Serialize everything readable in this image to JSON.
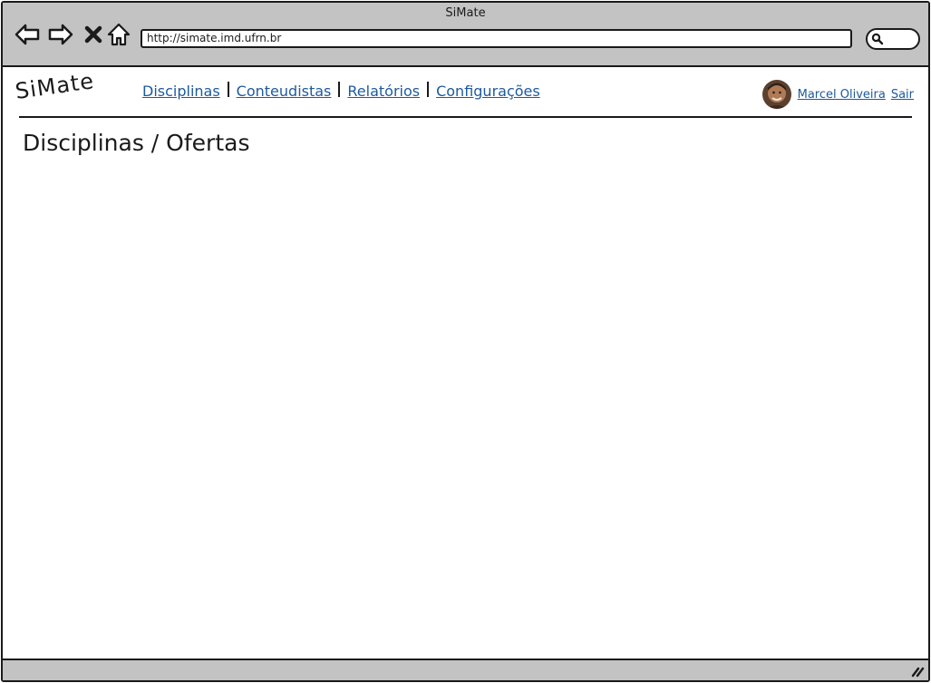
{
  "window": {
    "title": "SiMate"
  },
  "browser": {
    "url": "http://simate.imd.ufrn.br"
  },
  "app": {
    "logo": "SiMate",
    "nav": [
      {
        "label": "Disciplinas"
      },
      {
        "label": "Conteudistas"
      },
      {
        "label": "Relatórios"
      },
      {
        "label": "Configurações"
      }
    ],
    "user": {
      "name": "Marcel Oliveira",
      "logout_label": "Sair"
    }
  },
  "page": {
    "title": "Disciplinas / Ofertas"
  },
  "colors": {
    "chrome": "#c3c3c3",
    "link": "#1e5a9c",
    "ink": "#1a1a1a"
  }
}
